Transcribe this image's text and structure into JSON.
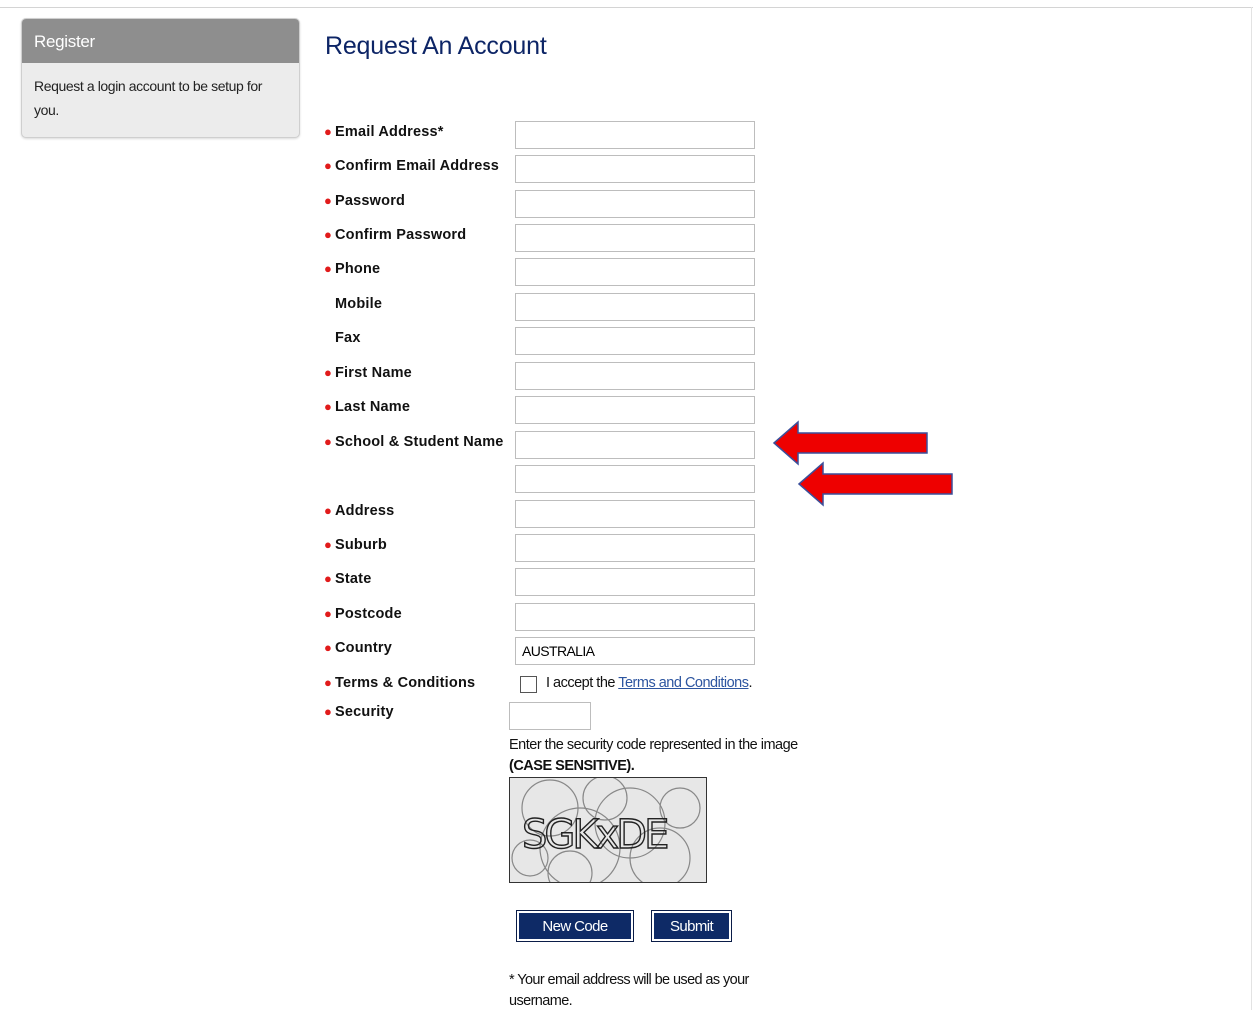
{
  "sidebar": {
    "header": "Register",
    "description": "Request a login account to be setup for you."
  },
  "page": {
    "title": "Request An Account"
  },
  "form": {
    "email_label": "Email Address*",
    "confirm_email_label": "Confirm Email Address",
    "password_label": "Password",
    "confirm_password_label": "Confirm Password",
    "phone_label": "Phone",
    "mobile_label": "Mobile",
    "fax_label": "Fax",
    "first_name_label": "First Name",
    "last_name_label": "Last Name",
    "school_label": "School & Student Name",
    "address_label": "Address",
    "suburb_label": "Suburb",
    "state_label": "State",
    "postcode_label": "Postcode",
    "country_label": "Country",
    "country_value": "AUSTRALIA",
    "terms_label": "Terms & Conditions",
    "terms_accept_prefix": "I accept the ",
    "terms_link": "Terms and Conditions",
    "terms_accept_suffix": ".",
    "security_label": "Security",
    "security_help_line1": "Enter the security code represented in the image",
    "security_help_line2": "(CASE SENSITIVE).",
    "captcha_text": "SGKxDE",
    "new_code_label": "New Code",
    "submit_label": "Submit",
    "footnote": "* Your email address will be used as your username."
  },
  "icons": {
    "required": "red-dot-icon",
    "annotation": "red-arrow-icon"
  },
  "colors": {
    "title": "#0d2566",
    "button": "#0e2a66",
    "required_dot": "#e11b1b",
    "annotation_arrow": "#ee0000",
    "link": "#2d55a0"
  }
}
